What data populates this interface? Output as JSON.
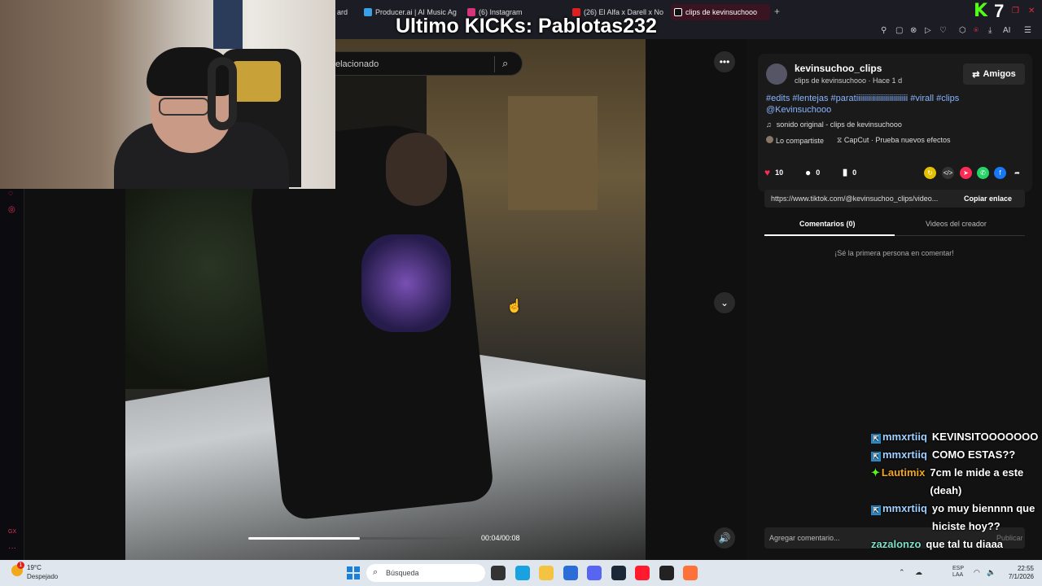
{
  "overlay_title": "Ultimo KICKs: Pablotas232",
  "browser": {
    "tabs": [
      {
        "label": "ard",
        "color": ""
      },
      {
        "label": "Producer.ai | AI Music Ag",
        "color": "#3aa0e8"
      },
      {
        "label": "(6) Instagram",
        "color": "#d6337a"
      },
      {
        "label": "(26) El Alfa x Darell x Nor",
        "color": "#e02020"
      },
      {
        "label": "clips de kevinsuchooo",
        "color": "#ffffff"
      }
    ],
    "new_tab": "+"
  },
  "kick": {
    "logo": "K",
    "count": "7"
  },
  "search": {
    "placeholder": "elacionado"
  },
  "video": {
    "time": "00:04/00:08",
    "progress": 0.5
  },
  "post": {
    "username": "kevinsuchoo_clips",
    "subline": "clips de kevinsuchooo · Hace 1 d",
    "friends_label": "Amigos",
    "hashtags": "#edits #lentejas #paratiiiiiiiiiiiiiiiiiiiiiiiiii #virall #clips @Kevinsuchooo",
    "sound": "sonido original - clips de kevinsuchooo",
    "shared": "Lo compartiste",
    "capcut": "CapCut · Prueba nuevos efectos",
    "likes": "10",
    "comments": "0",
    "saves": "0",
    "link": "https://www.tiktok.com/@kevinsuchoo_clips/video...",
    "copy_label": "Copiar enlace",
    "tab_comments": "Comentarios (0)",
    "tab_videos": "Videos del creador",
    "empty": "¡Sé la primera persona en comentar!",
    "comment_placeholder": "Agregar comentario...",
    "post_label": "Publicar"
  },
  "chat": [
    {
      "user": "mmxrtiiq",
      "msg": "KEVINSITOOOOOOO",
      "user_color": "#9fd0ff",
      "badge": "sub"
    },
    {
      "user": "mmxrtiiq",
      "msg": "COMO ESTAS??",
      "user_color": "#9fd0ff",
      "badge": "sub"
    },
    {
      "user": "Lautimix",
      "msg": "7cm le mide a este (deah)",
      "user_color": "#f2a81b",
      "badge": "star"
    },
    {
      "user": "mmxrtiiq",
      "msg": "yo muy biennnn que hiciste hoy??",
      "user_color": "#9fd0ff",
      "badge": "sub"
    },
    {
      "user": "zazalonzo",
      "msg": "que tal tu diaaa",
      "user_color": "#7fe0c8",
      "badge": ""
    }
  ],
  "taskbar": {
    "temp": "19°C",
    "weather": "Despejado",
    "search_placeholder": "Búsqueda",
    "time": "22:55",
    "date": "7/1/2026",
    "lang": "ESP",
    "lang2": "LAA",
    "notif": "1"
  },
  "left_label": "GX"
}
